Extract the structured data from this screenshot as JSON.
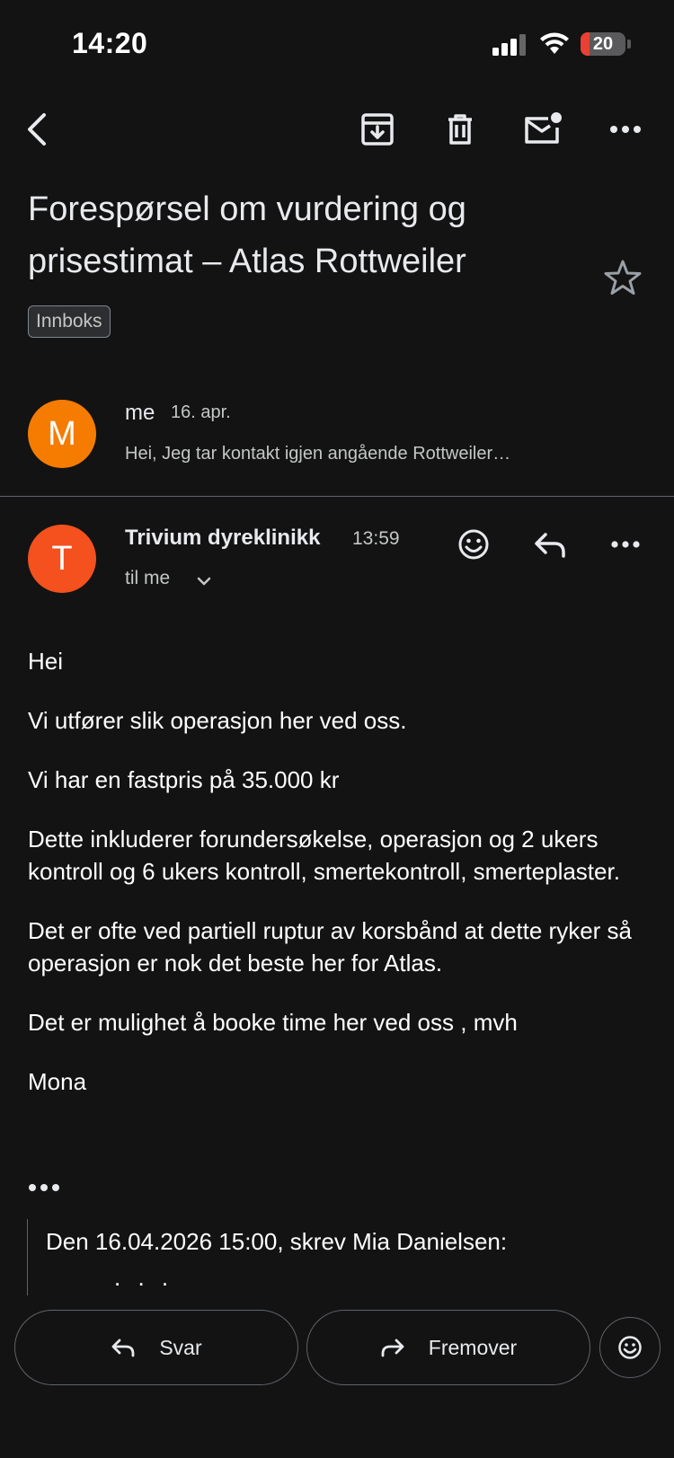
{
  "status": {
    "time": "14:20",
    "battery": "20"
  },
  "toolbar": {
    "back_icon": "back-arrow-icon",
    "archive_icon": "archive-icon",
    "delete_icon": "trash-icon",
    "unread_icon": "mark-unread-icon",
    "more_icon": "more-icon"
  },
  "email": {
    "subject": "Forespørsel om vurdering og prisestimat – Atlas Rottweiler",
    "label": "Innboks",
    "star_icon": "star-outline-icon"
  },
  "messages": [
    {
      "avatar_letter": "M",
      "avatar_color": "#f57c00",
      "sender": "me",
      "date": "16. apr.",
      "snippet": "Hei, Jeg tar kontakt igjen angående Rottweiler…"
    },
    {
      "avatar_letter": "T",
      "avatar_color": "#f4511e",
      "sender": "Trivium dyreklinikk",
      "time": "13:59",
      "to": "til me",
      "body": [
        "Hei",
        "Vi utfører slik operasjon her ved oss.",
        "Vi har en fastpris på 35.000 kr",
        "Dette inkluderer forundersøkelse, operasjon og 2 ukers kontroll og 6 ukers kontroll, smertekontroll, smerteplaster.",
        "Det er ofte ved partiell ruptur av korsbånd at dette ryker så operasjon er nok det beste her for Atlas.",
        "Det er mulighet å booke time her ved oss , mvh",
        "Mona"
      ],
      "quote_header": "Den 16.04.2026 15:00, skrev Mia Danielsen:",
      "quote_trailing": ". . ."
    }
  ],
  "bottom": {
    "reply_label": "Svar",
    "forward_label": "Fremover"
  }
}
